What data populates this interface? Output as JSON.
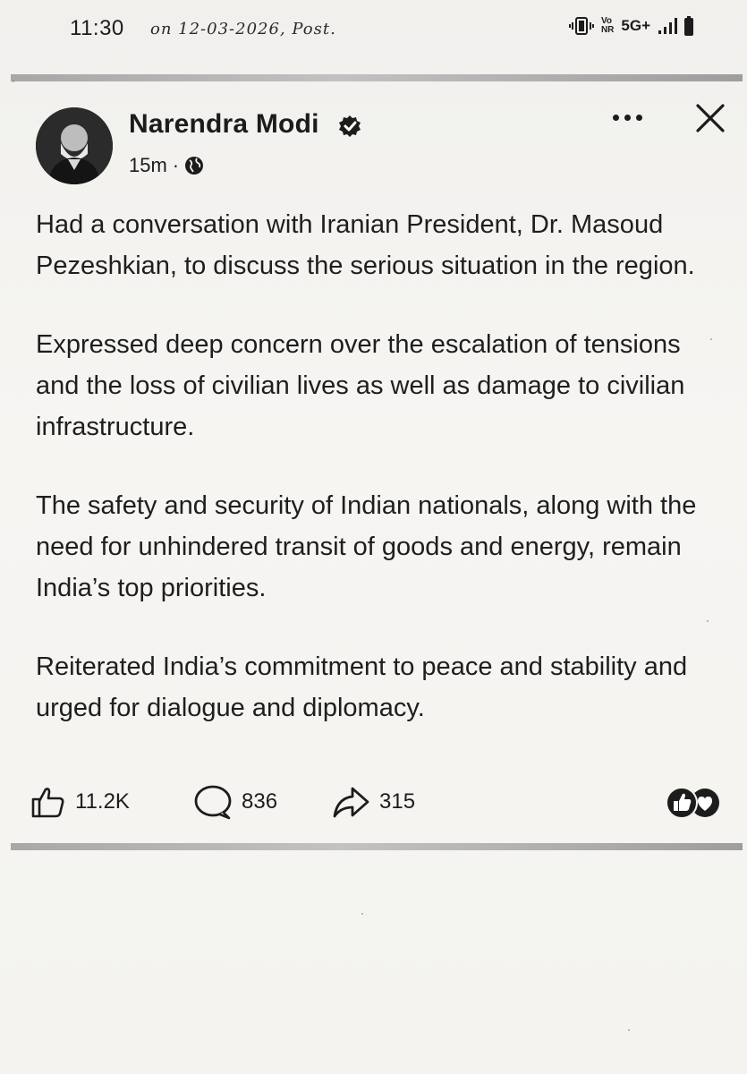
{
  "status_bar": {
    "time": "11:30",
    "handwritten_note": "on 12-03-2026, Post.",
    "volte_top": "Vo",
    "volte_bottom": "NR",
    "network": "5G+"
  },
  "post": {
    "author_name": "Narendra Modi",
    "time_ago": "15m",
    "separator": "·",
    "paragraphs": [
      "Had a conversation with Iranian President, Dr. Masoud Pezeshkian, to discuss the serious situation in the region.",
      "Expressed deep concern over the escalation of tensions and the loss of civilian lives as well as damage to civilian infrastructure.",
      "The safety and security of Indian nationals, along with the need for unhindered transit of goods and energy, remain India’s top priorities.",
      "Reiterated India’s commitment to peace and stability and urged for dialogue and diplomacy."
    ],
    "likes": "11.2K",
    "comments": "836",
    "shares": "315"
  },
  "icons": {
    "vibrate": "vibrate-icon",
    "signal": "signal-icon",
    "battery": "battery-icon",
    "verified": "verified-badge-icon",
    "globe": "globe-icon",
    "more": "more-horizontal-icon",
    "close": "close-icon",
    "like": "thumbs-up-icon",
    "comment": "comment-bubble-icon",
    "share": "share-arrow-icon",
    "reactions": "reactions-icon"
  }
}
